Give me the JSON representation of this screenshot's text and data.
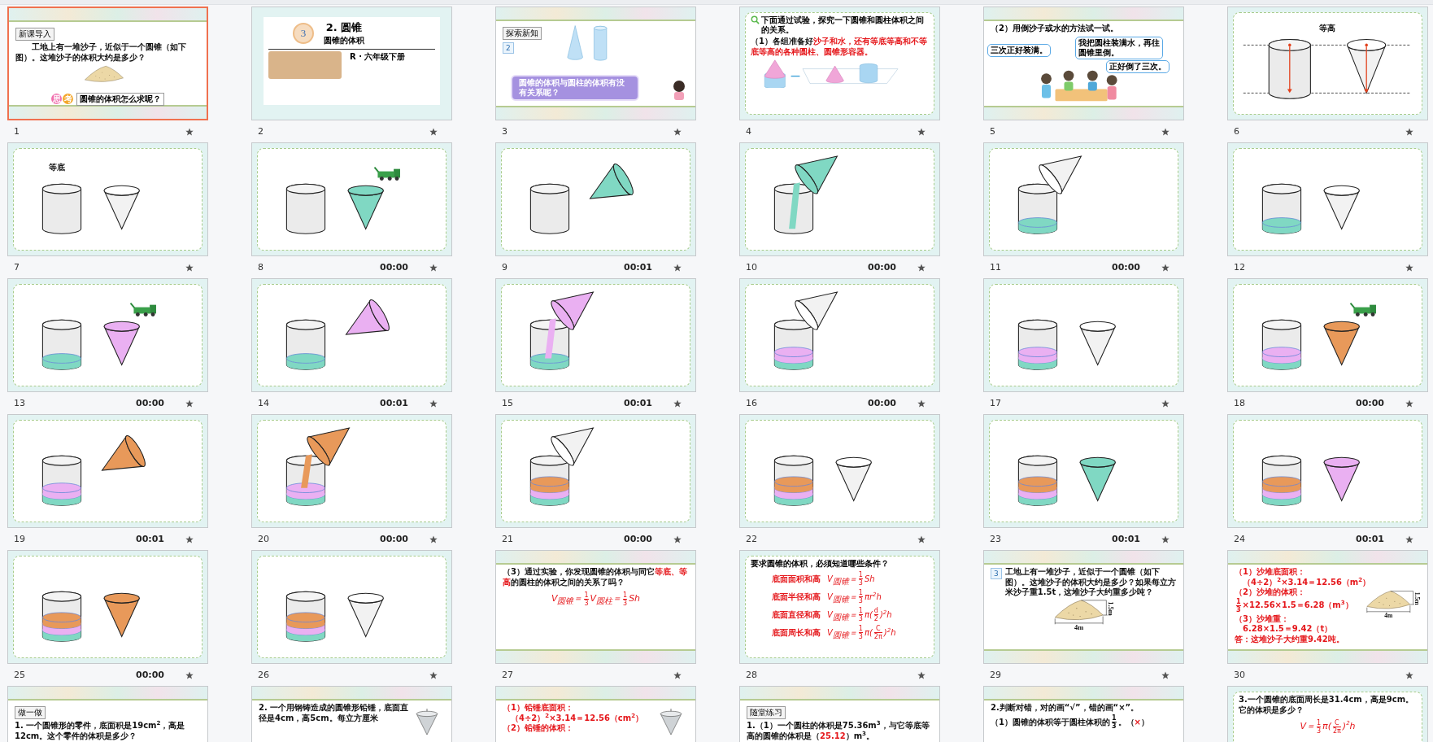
{
  "slides": [
    {
      "number": "1",
      "selected": true,
      "star": true,
      "kind": "intro",
      "tag": "新课导入",
      "blocks": [
        {
          "kind": "para",
          "parts": [
            {
              "text": "工地上有一堆沙子，近似于一个圆锥（如下图）。这堆沙子的体积大约是多少？",
              "red": false
            }
          ]
        }
      ],
      "figure": {
        "kind": "sand"
      },
      "think": [
        "思",
        "考"
      ],
      "question": "圆锥的体积怎么求呢？"
    },
    {
      "number": "2",
      "selected": false,
      "star": true,
      "kind": "title",
      "chapter": "3",
      "title": "2. 圆锥",
      "subtitle": "圆锥的体积",
      "edition": "R · 六年级下册"
    },
    {
      "number": "3",
      "selected": false,
      "star": true,
      "kind": "explore",
      "tag": "探索新知",
      "book": "2",
      "figure": {
        "kind": "cone-cylinder"
      },
      "bubble": "圆锥的体积与圆柱的体积有没有关系呢？"
    },
    {
      "number": "4",
      "selected": false,
      "star": true,
      "kind": "inquiry",
      "heading": "下面通过试验，探究一下圆锥和圆柱体积之间的关系。",
      "blocks": [
        {
          "kind": "para",
          "parts": [
            {
              "text": "（1）各组准备好",
              "red": false
            },
            {
              "text": "沙子和水，还有等底等高和不等底等高的各种圆柱、圆锥形容器。",
              "red": true
            }
          ]
        }
      ],
      "figure": {
        "kind": "shapes"
      }
    },
    {
      "number": "5",
      "selected": false,
      "star": true,
      "kind": "talk",
      "heading": "（2）用倒沙子或水的方法试一试。",
      "figure": {
        "kind": "children"
      },
      "bubbles": [
        "三次正好装满。",
        "我把圆柱装满水，再往圆锥里倒。",
        "正好倒了三次。"
      ]
    },
    {
      "number": "6",
      "selected": false,
      "star": true,
      "kind": "height",
      "label": "等高"
    },
    {
      "number": "7",
      "selected": false,
      "star": true,
      "kind": "experiment",
      "label": "等底",
      "cone": {
        "kind": "upright"
      },
      "truck": false
    },
    {
      "number": "8",
      "selected": false,
      "star": true,
      "timing": "00:00",
      "kind": "experiment",
      "cone": {
        "kind": "upright",
        "color": "#80d8c3"
      },
      "truck": true
    },
    {
      "number": "9",
      "selected": false,
      "star": true,
      "timing": "00:01",
      "kind": "experiment",
      "cone": {
        "kind": "tilted",
        "color": "#80d8c3"
      },
      "truck": false
    },
    {
      "number": "10",
      "selected": false,
      "star": true,
      "timing": "00:00",
      "kind": "experiment",
      "cone": {
        "kind": "pouring",
        "color": "#80d8c3"
      },
      "truck": false
    },
    {
      "number": "11",
      "selected": false,
      "star": true,
      "timing": "00:00",
      "kind": "experiment",
      "layers": [
        {
          "color": "#80d8c3"
        }
      ],
      "cone": {
        "kind": "over"
      },
      "truck": false
    },
    {
      "number": "12",
      "selected": false,
      "star": true,
      "kind": "experiment",
      "layers": [
        {
          "color": "#80d8c3"
        }
      ],
      "cone": {
        "kind": "upright"
      },
      "truck": false
    },
    {
      "number": "13",
      "selected": false,
      "star": true,
      "timing": "00:00",
      "kind": "experiment",
      "layers": [
        {
          "color": "#80d8c3"
        }
      ],
      "cone": {
        "kind": "upright",
        "color": "#eab0f2"
      },
      "truck": true
    },
    {
      "number": "14",
      "selected": false,
      "star": true,
      "timing": "00:01",
      "kind": "experiment",
      "layers": [
        {
          "color": "#80d8c3"
        }
      ],
      "cone": {
        "kind": "tilted",
        "color": "#eab0f2"
      },
      "truck": false
    },
    {
      "number": "15",
      "selected": false,
      "star": true,
      "timing": "00:01",
      "kind": "experiment",
      "layers": [
        {
          "color": "#80d8c3"
        }
      ],
      "cone": {
        "kind": "pouring",
        "color": "#eab0f2"
      },
      "truck": false
    },
    {
      "number": "16",
      "selected": false,
      "star": true,
      "timing": "00:00",
      "kind": "experiment",
      "layers": [
        {
          "color": "#80d8c3"
        },
        {
          "color": "#eab0f2"
        }
      ],
      "cone": {
        "kind": "over"
      },
      "truck": false
    },
    {
      "number": "17",
      "selected": false,
      "star": true,
      "kind": "experiment",
      "layers": [
        {
          "color": "#80d8c3"
        },
        {
          "color": "#eab0f2"
        }
      ],
      "cone": {
        "kind": "upright"
      },
      "truck": false
    },
    {
      "number": "18",
      "selected": false,
      "star": true,
      "timing": "00:00",
      "kind": "experiment",
      "layers": [
        {
          "color": "#80d8c3"
        },
        {
          "color": "#eab0f2"
        }
      ],
      "cone": {
        "kind": "upright",
        "color": "#e8995a"
      },
      "truck": true
    },
    {
      "number": "19",
      "selected": false,
      "star": true,
      "timing": "00:01",
      "kind": "experiment",
      "layers": [
        {
          "color": "#80d8c3"
        },
        {
          "color": "#eab0f2"
        }
      ],
      "cone": {
        "kind": "tilted",
        "color": "#e8995a"
      },
      "truck": false
    },
    {
      "number": "20",
      "selected": false,
      "star": true,
      "timing": "00:00",
      "kind": "experiment",
      "layers": [
        {
          "color": "#80d8c3"
        },
        {
          "color": "#eab0f2"
        }
      ],
      "cone": {
        "kind": "pouring",
        "color": "#e8995a"
      },
      "truck": false
    },
    {
      "number": "21",
      "selected": false,
      "star": true,
      "timing": "00:00",
      "kind": "experiment",
      "layers": [
        {
          "color": "#80d8c3"
        },
        {
          "color": "#eab0f2"
        },
        {
          "color": "#e8995a"
        }
      ],
      "cone": {
        "kind": "over"
      },
      "truck": false
    },
    {
      "number": "22",
      "selected": false,
      "star": true,
      "kind": "experiment",
      "layers": [
        {
          "color": "#80d8c3"
        },
        {
          "color": "#eab0f2"
        },
        {
          "color": "#e8995a"
        }
      ],
      "cone": {
        "kind": "upright"
      },
      "truck": false
    },
    {
      "number": "23",
      "selected": false,
      "star": true,
      "timing": "00:01",
      "kind": "experiment",
      "layers": [
        {
          "color": "#80d8c3"
        },
        {
          "color": "#eab0f2"
        },
        {
          "color": "#e8995a"
        }
      ],
      "cone": {
        "kind": "upright",
        "color": "#80d8c3"
      },
      "truck": false
    },
    {
      "number": "24",
      "selected": false,
      "star": true,
      "timing": "00:01",
      "kind": "experiment",
      "layers": [
        {
          "color": "#80d8c3"
        },
        {
          "color": "#eab0f2"
        },
        {
          "color": "#e8995a"
        }
      ],
      "cone": {
        "kind": "upright",
        "color": "#eab0f2"
      },
      "truck": false
    },
    {
      "number": "25",
      "selected": false,
      "star": true,
      "timing": "00:00",
      "kind": "experiment",
      "layers": [
        {
          "color": "#80d8c3"
        },
        {
          "color": "#eab0f2"
        },
        {
          "color": "#e8995a"
        }
      ],
      "cone": {
        "kind": "upright",
        "color": "#e8995a"
      },
      "truck": false
    },
    {
      "number": "26",
      "selected": false,
      "star": true,
      "kind": "experiment",
      "layers": [
        {
          "color": "#80d8c3"
        },
        {
          "color": "#eab0f2"
        },
        {
          "color": "#e8995a"
        }
      ],
      "cone": {
        "kind": "upright"
      },
      "truck": false
    },
    {
      "number": "27",
      "selected": false,
      "star": true,
      "kind": "text",
      "blocks": [
        {
          "kind": "para",
          "parts": [
            {
              "text": "（3）通过实验，你发现圆锥的体积与同它",
              "red": false
            },
            {
              "text": "等底、等高",
              "red": true
            },
            {
              "text": "的圆柱的体积之间的关系了吗？",
              "red": false
            }
          ]
        },
        {
          "kind": "formula",
          "parts": [
            {
              "text": "V$_{圆锥}$＝",
              "red": true
            },
            {
              "frac": [
                "1",
                "3"
              ],
              "red": true
            },
            {
              "text": "V$_{圆柱}$＝",
              "red": true
            },
            {
              "frac": [
                "1",
                "3"
              ],
              "red": true
            },
            {
              "text": "Sh",
              "red": true
            }
          ]
        }
      ]
    },
    {
      "number": "28",
      "selected": false,
      "star": true,
      "kind": "card-text",
      "heading": "要求圆锥的体积，必须知道哪些条件？",
      "blocks": [
        {
          "kind": "condition",
          "label": "底面面积和高",
          "parts": [
            {
              "text": "V$_{圆锥}$＝",
              "red": true
            },
            {
              "frac": [
                "1",
                "3"
              ],
              "red": true
            },
            {
              "text": "Sh",
              "red": true
            }
          ]
        },
        {
          "kind": "condition",
          "label": "底面半径和高",
          "parts": [
            {
              "text": "V$_{圆锥}$＝",
              "red": true
            },
            {
              "frac": [
                "1",
                "3"
              ],
              "red": true
            },
            {
              "text": "πr$^{2}$h",
              "red": true
            }
          ]
        },
        {
          "kind": "condition",
          "label": "底面直径和高",
          "parts": [
            {
              "text": "V$_{圆锥}$＝",
              "red": true
            },
            {
              "frac": [
                "1",
                "3"
              ],
              "red": true
            },
            {
              "text": "π(",
              "red": true
            },
            {
              "frac": [
                "d",
                "2"
              ],
              "red": true
            },
            {
              "text": ")$^{2}$h",
              "red": true
            }
          ]
        },
        {
          "kind": "condition",
          "label": "底面周长和高",
          "parts": [
            {
              "text": "V$_{圆锥}$＝",
              "red": true
            },
            {
              "frac": [
                "1",
                "3"
              ],
              "red": true
            },
            {
              "text": "π(",
              "red": true
            },
            {
              "frac": [
                "C",
                "2π"
              ],
              "red": true
            },
            {
              "text": ")$^{2}$h",
              "red": true
            }
          ]
        }
      ]
    },
    {
      "number": "29",
      "selected": false,
      "star": true,
      "kind": "text",
      "book": "3",
      "blocks": [
        {
          "kind": "para",
          "parts": [
            {
              "text": "工地上有一堆沙子，近似于一个圆锥（如下图）。这堆沙子的体积大约是多少？如果每立方米沙子重1.5t，这堆沙子大约重多少吨？",
              "red": false
            }
          ]
        }
      ],
      "figure": {
        "kind": "sand-dims",
        "labels": [
          "1.5m",
          "4m"
        ]
      }
    },
    {
      "number": "30",
      "selected": false,
      "star": true,
      "kind": "text",
      "blocks": [
        {
          "kind": "line",
          "parts": [
            {
              "text": "（1）沙堆底面积：",
              "red": true
            }
          ]
        },
        {
          "kind": "line",
          "parts": [
            {
              "text": "　（4÷2）$^{2}$×3.14＝12.56（m$^{2}$）",
              "red": true
            }
          ]
        },
        {
          "kind": "line",
          "parts": [
            {
              "text": "（2）沙堆的体积：",
              "red": true
            }
          ]
        },
        {
          "kind": "line",
          "parts": [
            {
              "frac": [
                "1",
                "3"
              ],
              "red": true
            },
            {
              "text": "×12.56×1.5＝6.28（m$^{3}$）",
              "red": true
            }
          ]
        },
        {
          "kind": "line",
          "parts": [
            {
              "text": "（3）沙堆重：",
              "red": true
            }
          ]
        },
        {
          "kind": "line",
          "parts": [
            {
              "text": "　6.28×1.5＝9.42（t）",
              "red": true
            }
          ]
        },
        {
          "kind": "line",
          "parts": [
            {
              "text": "答：这堆沙子大约重9.42吨。",
              "red": true
            }
          ]
        }
      ],
      "figure": {
        "kind": "sand-dims-side",
        "labels": [
          "1.5m",
          "4m"
        ]
      }
    },
    {
      "selected": false,
      "kind": "text",
      "tag": "做一做",
      "blocks": [
        {
          "kind": "para",
          "parts": [
            {
              "text": "1. 一个圆锥形的零件，底面积是19cm$^{2}$，高是12cm。这个零件的体积是多少？",
              "red": false
            }
          ]
        }
      ]
    },
    {
      "selected": false,
      "kind": "text",
      "blocks": [
        {
          "kind": "para",
          "parts": [
            {
              "text": "2. 一个用钢铸造成的圆锥形铅锤，底面直径是4cm，高5cm。每立方厘米",
              "red": false
            }
          ]
        }
      ],
      "figure": {
        "kind": "weight"
      }
    },
    {
      "selected": false,
      "kind": "text",
      "blocks": [
        {
          "kind": "line",
          "parts": [
            {
              "text": "（1）铅锤底面积：",
              "red": true
            }
          ]
        },
        {
          "kind": "line",
          "parts": [
            {
              "text": "　（4÷2）$^{2}$×3.14＝12.56（cm$^{2}$）",
              "red": true
            }
          ]
        },
        {
          "kind": "line",
          "parts": [
            {
              "text": "（2）铅锤的体积：",
              "red": true
            }
          ]
        }
      ],
      "figure": {
        "kind": "weight"
      }
    },
    {
      "selected": false,
      "kind": "text",
      "tag": "随堂练习",
      "blocks": [
        {
          "kind": "para",
          "parts": [
            {
              "text": "1.（1）一个圆柱的体积是75.36m$^{3}$，与它等底等高的圆锥的体积是（",
              "red": false
            },
            {
              "text": "25.12",
              "red": true
            },
            {
              "text": "）m$^{3}$。",
              "red": false
            }
          ]
        }
      ]
    },
    {
      "selected": false,
      "kind": "text",
      "blocks": [
        {
          "kind": "para",
          "parts": [
            {
              "text": "2.判断对错，对的画“√”，错的画“×”。",
              "red": false
            }
          ]
        },
        {
          "kind": "para",
          "parts": [
            {
              "text": "（1）圆锥的体积等于圆柱体积的",
              "red": false
            },
            {
              "frac": [
                "1",
                "3"
              ],
              "red": false
            },
            {
              "text": "。（",
              "red": false
            },
            {
              "text": "×",
              "red": true
            },
            {
              "text": "）",
              "red": false
            }
          ]
        }
      ]
    },
    {
      "selected": false,
      "kind": "card-text",
      "blocks": [
        {
          "kind": "para",
          "parts": [
            {
              "text": "3.一个圆锥的底面周长是31.4cm，高是9cm。它的体积是多少？",
              "red": false
            }
          ]
        },
        {
          "kind": "formula",
          "parts": [
            {
              "text": "V＝",
              "red": true
            },
            {
              "frac": [
                "1",
                "3"
              ],
              "red": true
            },
            {
              "text": "π(",
              "red": true
            },
            {
              "frac": [
                "C",
                "2π"
              ],
              "red": true
            },
            {
              "text": ")$^{2}$h",
              "red": true
            }
          ]
        }
      ]
    }
  ]
}
